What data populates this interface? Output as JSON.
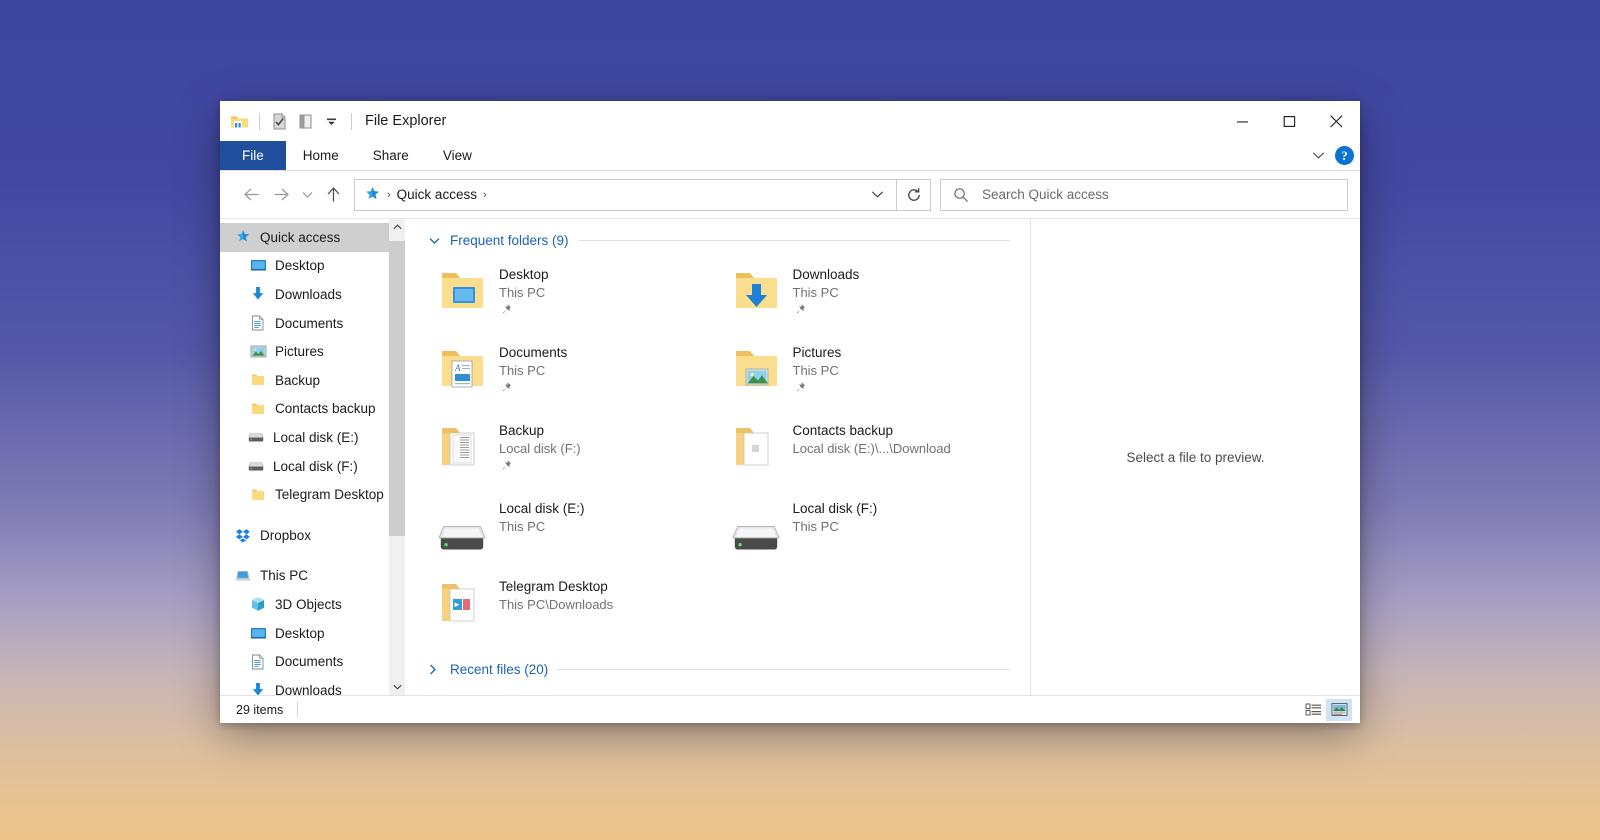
{
  "window": {
    "title": "File Explorer",
    "quick_access_toolbar": [
      {
        "icon": "folder-properties-icon",
        "name": "qat-folder-icon"
      },
      {
        "icon": "checkbox-properties-icon",
        "name": "qat-properties-icon"
      },
      {
        "icon": "new-folder-icon",
        "name": "qat-new-folder-icon"
      },
      {
        "icon": "chevron-down-icon",
        "name": "qat-customize-icon"
      }
    ],
    "controls": {
      "minimize": "–",
      "maximize": "☐",
      "close": "✕"
    }
  },
  "ribbon": {
    "tabs": [
      {
        "label": "File",
        "active": true
      },
      {
        "label": "Home",
        "active": false
      },
      {
        "label": "Share",
        "active": false
      },
      {
        "label": "View",
        "active": false
      }
    ],
    "collapse_icon": "chevron-down-icon",
    "help_label": "?"
  },
  "navigation": {
    "back_icon": "arrow-left-icon",
    "forward_icon": "arrow-right-icon",
    "recent_icon": "chevron-down-icon",
    "up_icon": "arrow-up-icon",
    "refresh_icon": "refresh-icon",
    "address": {
      "root_icon": "quick-access-star-icon",
      "crumb": "Quick access",
      "sep": "›",
      "dropdown_icon": "chevron-down-icon"
    },
    "search": {
      "icon": "search-icon",
      "placeholder": "Search Quick access",
      "value": ""
    }
  },
  "sidebar": {
    "items": [
      {
        "label": "Quick access",
        "icon": "quick-access-star-icon",
        "indent": 0,
        "selected": true,
        "pinned": false
      },
      {
        "label": "Desktop",
        "icon": "desktop-icon",
        "indent": 1,
        "selected": false,
        "pinned": true
      },
      {
        "label": "Downloads",
        "icon": "downloads-icon",
        "indent": 1,
        "selected": false,
        "pinned": true
      },
      {
        "label": "Documents",
        "icon": "documents-icon",
        "indent": 1,
        "selected": false,
        "pinned": true
      },
      {
        "label": "Pictures",
        "icon": "pictures-icon",
        "indent": 1,
        "selected": false,
        "pinned": true
      },
      {
        "label": "Backup",
        "icon": "folder-icon",
        "indent": 1,
        "selected": false,
        "pinned": true
      },
      {
        "label": "Contacts backup",
        "icon": "folder-icon",
        "indent": 1,
        "selected": false,
        "pinned": false
      },
      {
        "label": "Local disk (E:)",
        "icon": "drive-icon",
        "indent": 1,
        "selected": false,
        "pinned": false
      },
      {
        "label": "Local disk (F:)",
        "icon": "drive-icon",
        "indent": 1,
        "selected": false,
        "pinned": false
      },
      {
        "label": "Telegram Desktop",
        "icon": "folder-icon",
        "indent": 1,
        "selected": false,
        "pinned": false
      },
      {
        "label": "__GAP__",
        "icon": "",
        "indent": 0,
        "selected": false,
        "pinned": false
      },
      {
        "label": "Dropbox",
        "icon": "dropbox-icon",
        "indent": 0,
        "selected": false,
        "pinned": false
      },
      {
        "label": "__GAP__",
        "icon": "",
        "indent": 0,
        "selected": false,
        "pinned": false
      },
      {
        "label": "This PC",
        "icon": "this-pc-icon",
        "indent": 0,
        "selected": false,
        "pinned": false
      },
      {
        "label": "3D Objects",
        "icon": "3d-objects-icon",
        "indent": 1,
        "selected": false,
        "pinned": false
      },
      {
        "label": "Desktop",
        "icon": "desktop-icon",
        "indent": 1,
        "selected": false,
        "pinned": false
      },
      {
        "label": "Documents",
        "icon": "documents-icon",
        "indent": 1,
        "selected": false,
        "pinned": false
      },
      {
        "label": "Downloads",
        "icon": "downloads-icon",
        "indent": 1,
        "selected": false,
        "pinned": false
      }
    ],
    "scroll": {
      "up_icon": "chevron-up-icon",
      "down_icon": "chevron-down-icon"
    }
  },
  "main": {
    "groups": [
      {
        "title": "Frequent folders (9)",
        "expanded": true,
        "chevron": "chevron-down-icon",
        "items": [
          {
            "name": "Desktop",
            "sub": "This PC",
            "icon": "folder-desktop-icon",
            "pinned": true
          },
          {
            "name": "Downloads",
            "sub": "This PC",
            "icon": "folder-downloads-icon",
            "pinned": true
          },
          {
            "name": "Documents",
            "sub": "This PC",
            "icon": "folder-documents-icon",
            "pinned": true
          },
          {
            "name": "Pictures",
            "sub": "This PC",
            "icon": "folder-pictures-icon",
            "pinned": true
          },
          {
            "name": "Backup",
            "sub": "Local disk (F:)",
            "icon": "folder-files-icon",
            "pinned": true
          },
          {
            "name": "Contacts backup",
            "sub": "Local disk (E:)\\...\\Download",
            "icon": "folder-contacts-icon",
            "pinned": false
          },
          {
            "name": "Local disk (E:)",
            "sub": "This PC",
            "icon": "drive-large-icon",
            "pinned": false
          },
          {
            "name": "Local disk (F:)",
            "sub": "This PC",
            "icon": "drive-large-icon",
            "pinned": false
          },
          {
            "name": "Telegram Desktop",
            "sub": "This PC\\Downloads",
            "icon": "folder-telegram-icon",
            "pinned": false
          }
        ]
      },
      {
        "title": "Recent files (20)",
        "expanded": false,
        "chevron": "chevron-right-icon",
        "items": []
      }
    ]
  },
  "preview": {
    "message": "Select a file to preview."
  },
  "status": {
    "item_count": "29 items",
    "views": [
      {
        "icon": "details-view-icon",
        "active": false
      },
      {
        "icon": "large-icons-view-icon",
        "active": true
      }
    ]
  },
  "colors": {
    "file_tab": "#1f4e9c",
    "accent_link": "#1b63b5",
    "help_blue": "#0a72d4",
    "selection": "#cfcfcf",
    "folder_yellow": "#f9d67b"
  }
}
